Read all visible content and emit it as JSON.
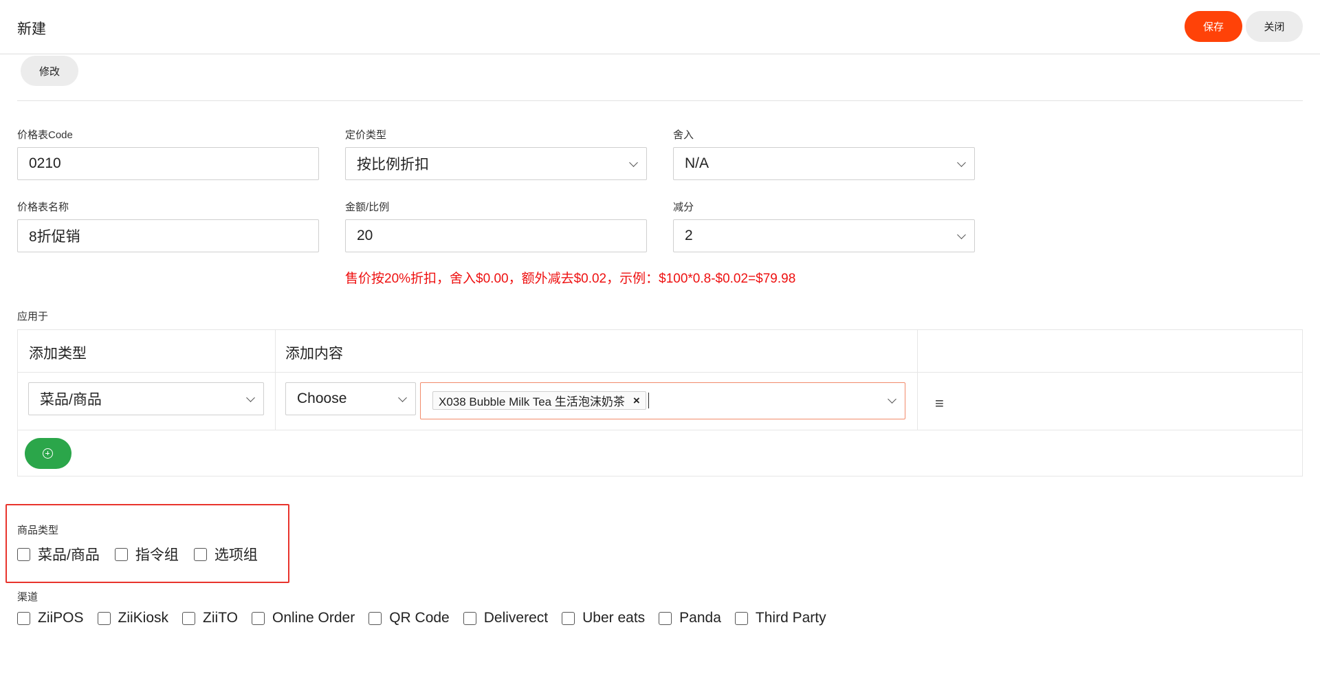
{
  "header": {
    "title": "新建",
    "save_label": "保存",
    "close_label": "关闭"
  },
  "edit_button": "修改",
  "form": {
    "code": {
      "label": "价格表Code",
      "value": "0210"
    },
    "pricing_type": {
      "label": "定价类型",
      "value": "按比例折扣"
    },
    "rounding": {
      "label": "舍入",
      "value": "N/A"
    },
    "name": {
      "label": "价格表名称",
      "value": "8折促销"
    },
    "amount_ratio": {
      "label": "金额/比例",
      "value": "20"
    },
    "cents_off": {
      "label": "减分",
      "value": "2"
    },
    "hint": "售价按20%折扣，舍入$0.00，额外减去$0.02，示例：$100*0.8-$0.02=$79.98"
  },
  "apply_to": {
    "label": "应用于",
    "col_type": "添加类型",
    "col_content": "添加内容",
    "row": {
      "type_value": "菜品/商品",
      "choose_value": "Choose",
      "tag": "X038 Bubble Milk Tea 生活泡沫奶茶",
      "tag_remove": "×",
      "menu_icon": "≡"
    }
  },
  "product_type": {
    "label": "商品类型",
    "options": [
      "菜品/商品",
      "指令组",
      "选项组"
    ]
  },
  "channels": {
    "label": "渠道",
    "options": [
      "ZiiPOS",
      "ZiiKiosk",
      "ZiiTO",
      "Online Order",
      "QR Code",
      "Deliverect",
      "Uber eats",
      "Panda",
      "Third Party"
    ]
  },
  "colors": {
    "accent": "#ff4208",
    "add": "#2ba64a",
    "hint": "#ee1010",
    "highlight": "#e8332c"
  }
}
